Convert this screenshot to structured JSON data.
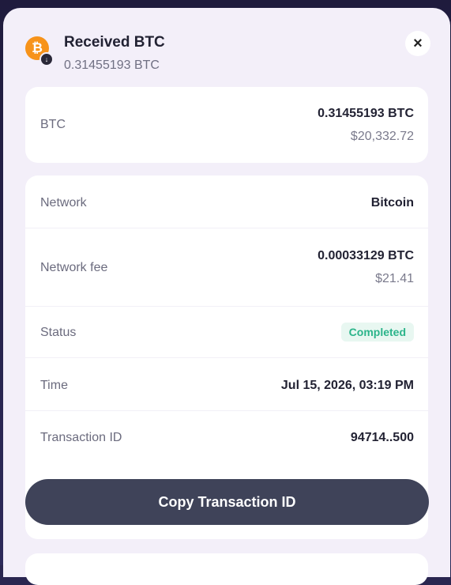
{
  "header": {
    "title": "Received BTC",
    "amount": "0.31455193 BTC",
    "coin_letter": "₿",
    "badge_icon": "↓",
    "close_icon": "×"
  },
  "summary": {
    "label": "BTC",
    "amount": "0.31455193 BTC",
    "fiat": "$20,332.72"
  },
  "details": {
    "network_label": "Network",
    "network_value": "Bitcoin",
    "fee_label": "Network fee",
    "fee_value": "0.00033129 BTC",
    "fee_fiat": "$21.41",
    "status_label": "Status",
    "status_value": "Completed",
    "time_label": "Time",
    "time_value": "Jul 15, 2026, 03:19 PM",
    "txid_label": "Transaction ID",
    "txid_value": "94714..500"
  },
  "actions": {
    "copy_label": "Copy Transaction ID"
  },
  "colors": {
    "sheet": "#f3eff9",
    "btc": "#f7931a",
    "status_ok": "#2bb48a",
    "button": "#3f4359"
  }
}
